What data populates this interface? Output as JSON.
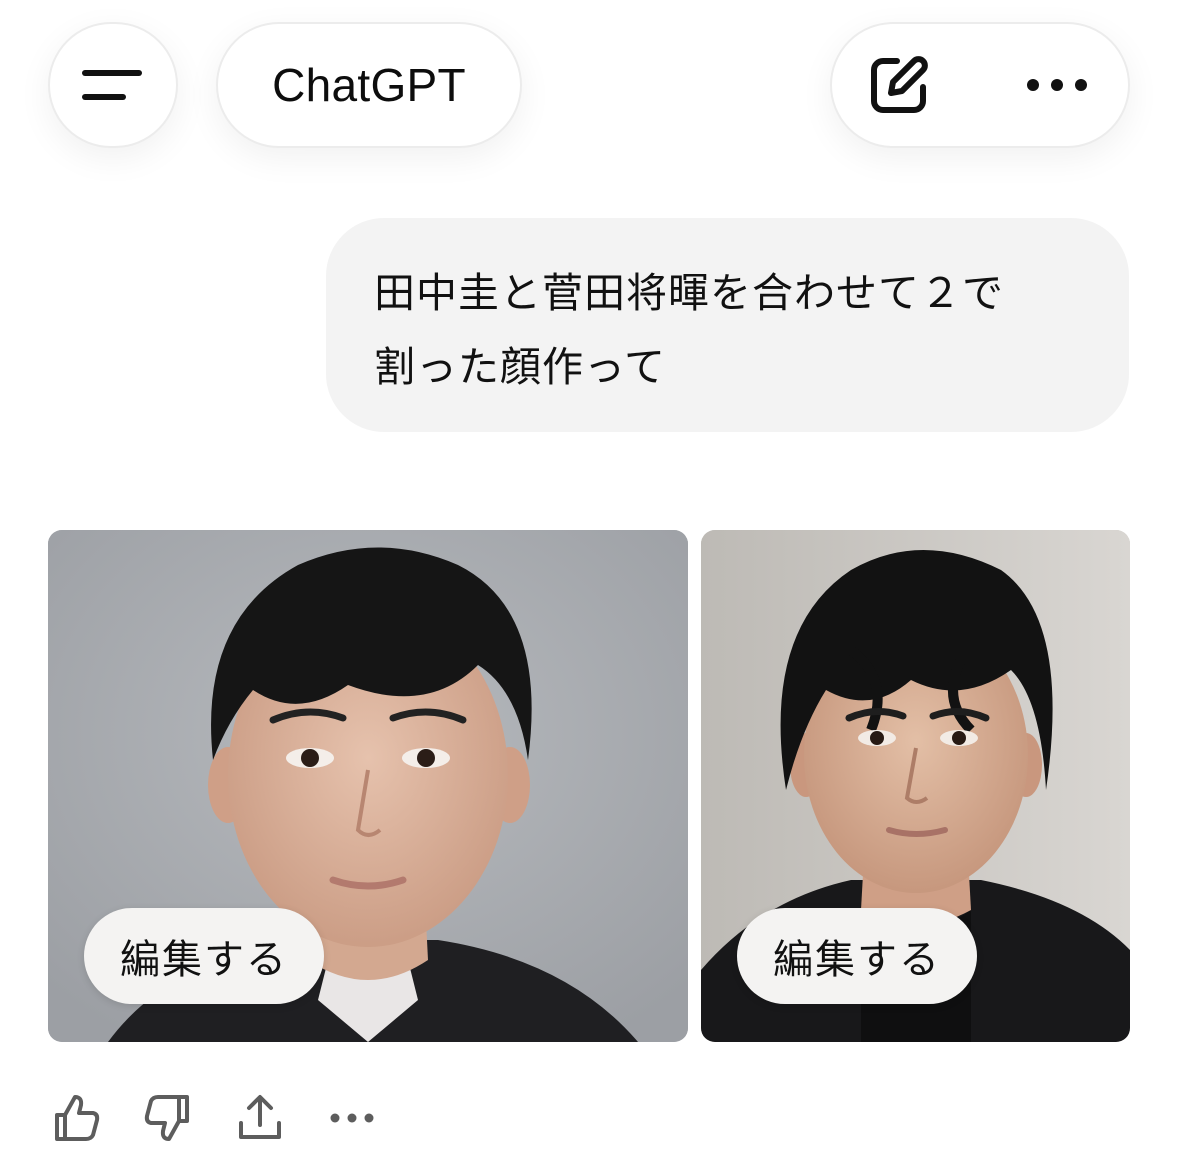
{
  "header": {
    "title": "ChatGPT",
    "menu_icon": "menu-icon",
    "new_chat_icon": "edit-icon",
    "more_icon": "more-icon"
  },
  "conversation": {
    "user_message": "田中圭と菅田将暉を合わせて２で\n割った顔作って",
    "images": [
      {
        "edit_label": "編集する",
        "description_icon": "portrait-image"
      },
      {
        "edit_label": "編集する",
        "description_icon": "portrait-image"
      }
    ]
  },
  "feedback_actions": [
    "thumbs-up-icon",
    "thumbs-down-icon",
    "share-icon",
    "more-icon"
  ],
  "colors": {
    "bubble_bg": "#f3f3f3",
    "text": "#0d0d0d",
    "image_bg_1": "#a9acb1",
    "image_bg_2": "#c6c3bf"
  }
}
